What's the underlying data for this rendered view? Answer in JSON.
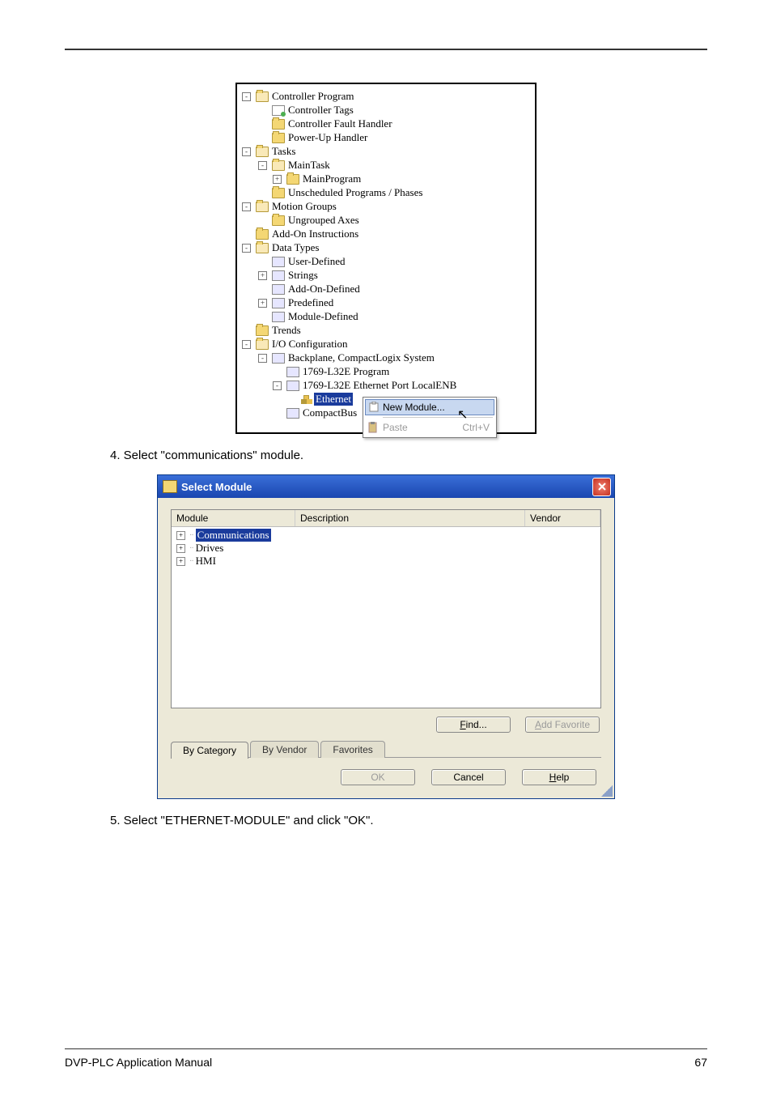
{
  "page": {
    "footer_left": "DVP-PLC Application Manual",
    "footer_right": "67"
  },
  "tree": {
    "items": [
      {
        "indent": 0,
        "box": "-",
        "icon": "folder-open",
        "label": "Controller Program"
      },
      {
        "indent": 1,
        "box": "",
        "icon": "tags",
        "label": "Controller Tags"
      },
      {
        "indent": 1,
        "box": "",
        "icon": "folder",
        "label": "Controller Fault Handler"
      },
      {
        "indent": 1,
        "box": "",
        "icon": "folder",
        "label": "Power-Up Handler"
      },
      {
        "indent": 0,
        "box": "-",
        "icon": "folder-open",
        "label": "Tasks"
      },
      {
        "indent": 1,
        "box": "-",
        "icon": "folder-open",
        "label": "MainTask"
      },
      {
        "indent": 2,
        "box": "+",
        "icon": "folder",
        "label": "MainProgram"
      },
      {
        "indent": 1,
        "box": "",
        "icon": "folder",
        "label": "Unscheduled Programs / Phases"
      },
      {
        "indent": 0,
        "box": "-",
        "icon": "folder-open",
        "label": "Motion Groups"
      },
      {
        "indent": 1,
        "box": "",
        "icon": "folder",
        "label": "Ungrouped Axes"
      },
      {
        "indent": 0,
        "box": "",
        "icon": "folder",
        "label": "Add-On Instructions"
      },
      {
        "indent": 0,
        "box": "-",
        "icon": "folder-open",
        "label": "Data Types"
      },
      {
        "indent": 1,
        "box": "",
        "icon": "chip",
        "label": "User-Defined"
      },
      {
        "indent": 1,
        "box": "+",
        "icon": "chip",
        "label": "Strings"
      },
      {
        "indent": 1,
        "box": "",
        "icon": "chip",
        "label": "Add-On-Defined"
      },
      {
        "indent": 1,
        "box": "+",
        "icon": "chip",
        "label": "Predefined"
      },
      {
        "indent": 1,
        "box": "",
        "icon": "chip",
        "label": "Module-Defined"
      },
      {
        "indent": 0,
        "box": "",
        "icon": "folder",
        "label": "Trends"
      },
      {
        "indent": 0,
        "box": "-",
        "icon": "folder-open",
        "label": "I/O Configuration"
      },
      {
        "indent": 1,
        "box": "-",
        "icon": "chip",
        "label": "Backplane, CompactLogix System"
      },
      {
        "indent": 2,
        "box": "",
        "icon": "chip",
        "label": "1769-L32E Program"
      },
      {
        "indent": 2,
        "box": "-",
        "icon": "chip",
        "label": "1769-L32E Ethernet Port LocalENB"
      },
      {
        "indent": 3,
        "box": "",
        "icon": "eth",
        "label": "Ethernet",
        "selected": true
      },
      {
        "indent": 2,
        "box": "",
        "icon": "chip",
        "label": "CompactBus"
      }
    ]
  },
  "context_menu": {
    "new_module": "New Module...",
    "paste": "Paste",
    "paste_shortcut": "Ctrl+V"
  },
  "step4": "4.   Select \"communications\" module.",
  "step5": "5.   Select \"ETHERNET-MODULE\" and click \"OK\".",
  "dialog": {
    "title": "Select Module",
    "columns": {
      "module": "Module",
      "description": "Description",
      "vendor": "Vendor"
    },
    "rows": [
      {
        "box": "+",
        "label": "Communications",
        "selected": true
      },
      {
        "box": "+",
        "label": "Drives",
        "selected": false
      },
      {
        "box": "+",
        "label": "HMI",
        "selected": false
      }
    ],
    "find": "Find...",
    "add_favorite": "Add Favorite",
    "tabs": {
      "by_category": "By Category",
      "by_vendor": "By Vendor",
      "favorites": "Favorites"
    },
    "ok": "OK",
    "cancel": "Cancel",
    "help": "Help"
  }
}
